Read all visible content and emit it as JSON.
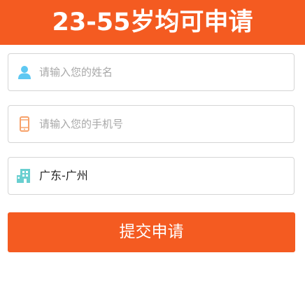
{
  "banner": {
    "title": "23-55岁均可申请"
  },
  "form": {
    "name_field": {
      "placeholder": "请输入您的姓名",
      "icon": "user-icon"
    },
    "phone_field": {
      "placeholder": "请输入您的手机号",
      "icon": "phone-icon"
    },
    "region_field": {
      "value": "广东-广州",
      "icon": "building-icon"
    },
    "submit_label": "提交申请"
  },
  "colors": {
    "accent": "#f45b21",
    "user_icon": "#5ec8f2",
    "phone_icon": "#f7a26b",
    "building_icon": "#69cfd0",
    "placeholder": "#a8a8a8",
    "border": "#d5d5d5"
  }
}
